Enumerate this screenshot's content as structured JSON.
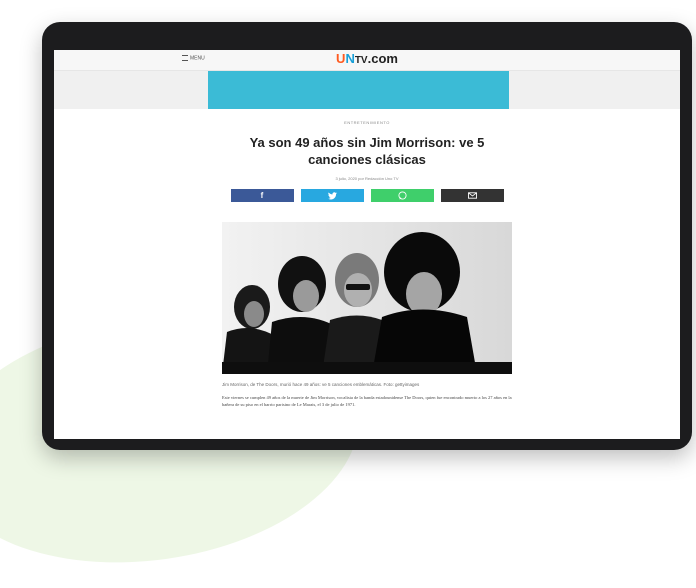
{
  "site": {
    "logo_u": "U",
    "logo_n": "N",
    "logo_tv": "TV",
    "logo_domain": ".com",
    "menu_label": "MENU"
  },
  "article": {
    "category": "ENTRETENIMIENTO",
    "title": "Ya son 49 años sin Jim Morrison: ve 5 canciones clásicas",
    "byline": "3 julio, 2020 por Redacción Uno TV",
    "caption": "Jim Morrison, de The Doors, murió hace 49 años: ve 5 canciones emblemáticas. Foto: gettyimages",
    "paragraph": "Este viernes se cumplen 49 años de la muerte de Jim Morrison, vocalista de la banda estadounidense The Doors, quien fue encontrado muerto a los 27 años en la bañera de su piso en el barrio parisino de Le Marais, el 3 de julio de 1971."
  },
  "share": {
    "facebook_icon": "facebook-icon",
    "twitter_icon": "twitter-icon",
    "whatsapp_icon": "whatsapp-icon",
    "email_icon": "email-icon"
  },
  "colors": {
    "ad_banner": "#3bbbd6",
    "facebook": "#3b5998",
    "twitter": "#28a8e0",
    "whatsapp": "#3fcf6b",
    "email": "#333333"
  }
}
